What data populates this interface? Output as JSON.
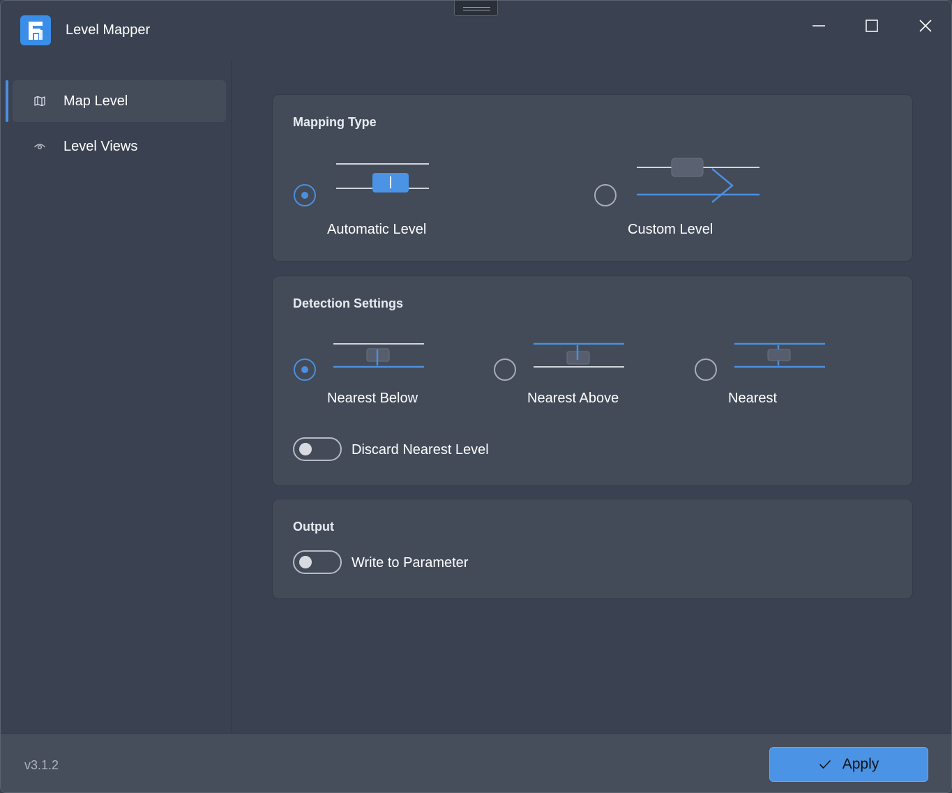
{
  "app": {
    "title": "Level Mapper",
    "version": "v3.1.2"
  },
  "window_controls": {
    "minimize": "minimize-icon",
    "maximize": "maximize-icon",
    "close": "close-icon"
  },
  "sidebar": {
    "items": [
      {
        "label": "Map Level",
        "icon": "map-icon",
        "active": true
      },
      {
        "label": "Level Views",
        "icon": "eye-icon",
        "active": false
      }
    ]
  },
  "mapping_type": {
    "title": "Mapping Type",
    "options": [
      {
        "label": "Automatic Level",
        "selected": true
      },
      {
        "label": "Custom Level",
        "selected": false
      }
    ]
  },
  "detection_settings": {
    "title": "Detection Settings",
    "options": [
      {
        "label": "Nearest Below",
        "selected": true
      },
      {
        "label": "Nearest Above",
        "selected": false
      },
      {
        "label": "Nearest",
        "selected": false
      }
    ],
    "discard_toggle": {
      "label": "Discard Nearest Level",
      "on": false
    }
  },
  "output": {
    "title": "Output",
    "write_toggle": {
      "label": "Write to Parameter",
      "on": false
    }
  },
  "footer": {
    "apply_label": "Apply",
    "apply_icon": "check-icon"
  },
  "colors": {
    "accent": "#4b8fe0",
    "background": "#3a4150",
    "card": "#434a58"
  }
}
